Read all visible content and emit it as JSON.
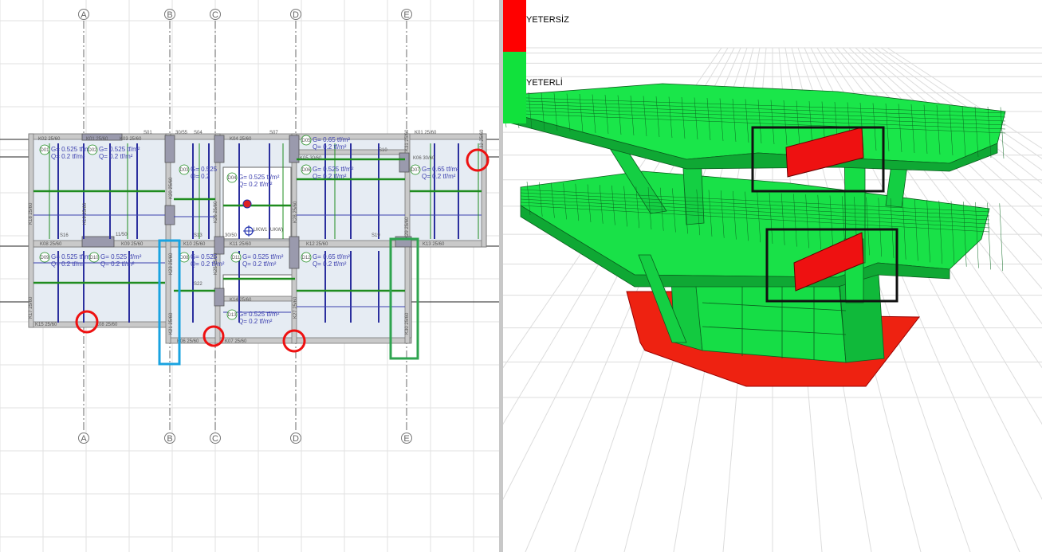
{
  "plan": {
    "axes": [
      "A",
      "B",
      "C",
      "D",
      "E"
    ],
    "beams": [
      "K02 25/60",
      "K01 25/60",
      "K03 25/60",
      "K04 25/60",
      "K01 25/60",
      "K05 30/60",
      "K06 30/60",
      "K08 25/60",
      "K09 25/60",
      "K12 25/60",
      "K13 25/60",
      "K14 25/60",
      "K15 25/60",
      "K06 25/60",
      "K07 25/60",
      "K08 25/60",
      "K10 25/60",
      "K11 25/60"
    ],
    "columns_vertical": [
      "K18 25/60",
      "K19 25/60",
      "K20 25/60",
      "K21 25/60",
      "K25 25/60",
      "K26 25/60",
      "K27 25/60",
      "K28 25/60",
      "K29 25/60",
      "K30 25/60",
      "K31 25/60",
      "K32 25/60",
      "K17 25/60",
      "K23 25/60"
    ],
    "slab_labels": [
      "S01",
      "S04",
      "S07",
      "S10",
      "S16",
      "S13",
      "S19",
      "S22",
      "30/55",
      "30/50",
      "11/50"
    ],
    "slab_loads": [
      {
        "id": "D01",
        "g": "G= 0.525 tf/m²",
        "q": "Q= 0.2 tf/m²"
      },
      {
        "id": "D02",
        "g": "G= 0.525 tf/m²",
        "q": "Q= 0.2 tf/m²"
      },
      {
        "id": "D03",
        "g": "G= 0.525",
        "q": "Q= 0.2"
      },
      {
        "id": "D04",
        "g": "G= 0.525 tf/m²",
        "q": "Q= 0.2 tf/m²"
      },
      {
        "id": "D05",
        "g": "G= 0.65 tf/m²",
        "q": "Q= 0.2 tf/m²"
      },
      {
        "id": "D06",
        "g": "G= 0.525 tf/m²",
        "q": "Q= 0.2 tf/m²"
      },
      {
        "id": "D07",
        "g": "G= 0.65 tf/m²",
        "q": "Q= 0.2 tf/m²"
      },
      {
        "id": "D08",
        "g": "G= 0.525",
        "q": "Q= 0.2 tf/m²"
      },
      {
        "id": "D09",
        "g": "G= 0.525 tf/m²",
        "q": "Q= 0.2 tf/m²"
      },
      {
        "id": "D10",
        "g": "G= 0.525 tf/m²",
        "q": "Q= 0.2 tf/m²"
      },
      {
        "id": "D11",
        "g": "G= 0.525 tf/m²",
        "q": "Q= 0.2 tf/m²"
      },
      {
        "id": "D12",
        "g": "G= 0.65 tf/m²",
        "q": "Q= 0.2 tf/m²"
      },
      {
        "id": "D13",
        "g": "G= 0.525 tf/m²",
        "q": "Q= 0.2 tf/m²"
      }
    ],
    "marker_label": "UKW1 (UKW)",
    "colors": {
      "beam_green": "#1f8c1f",
      "rebar_blue": "#2b2f9e",
      "slab_fill": "#e6ecf3",
      "highlight_red": "#e11",
      "highlight_blue": "#1aa3e0",
      "highlight_green": "#2ea44f"
    }
  },
  "legend": {
    "insufficient_label": "YETERSİZ",
    "sufficient_label": "YETERLİ",
    "insufficient_color": "#ff0000",
    "sufficient_color": "#11e13c"
  }
}
